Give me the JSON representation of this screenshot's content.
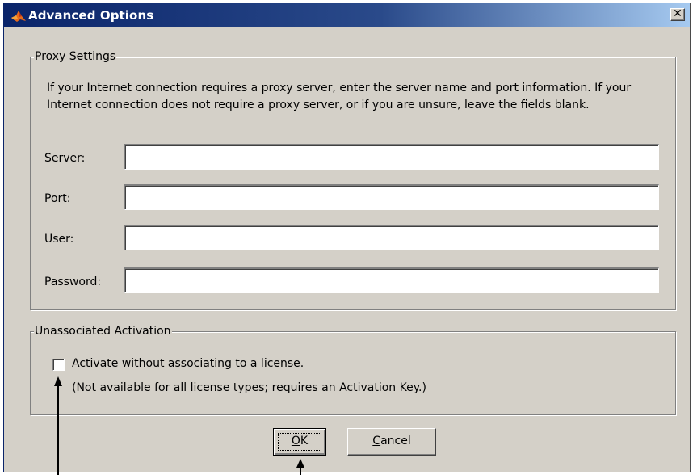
{
  "window": {
    "title": "Advanced Options",
    "close_glyph": "✕"
  },
  "proxy": {
    "legend": "Proxy Settings",
    "description": "If your Internet connection requires a proxy server, enter the server name and port information. If your Internet connection does not require a proxy server, or if you are unsure, leave the fields blank.",
    "server_label": "Server:",
    "server_value": "",
    "port_label": "Port:",
    "port_value": "",
    "user_label": "User:",
    "user_value": "",
    "password_label": "Password:",
    "password_value": ""
  },
  "activation": {
    "legend": "Unassociated Activation",
    "checkbox_label": "Activate without associating to a license.",
    "checked": false,
    "note": "(Not available for all license types; requires an Activation Key.)"
  },
  "buttons": {
    "ok_mnemonic": "O",
    "ok_rest": "K",
    "cancel_mnemonic": "C",
    "cancel_rest": "ancel"
  },
  "colors": {
    "titlebar_start": "#0a246a",
    "titlebar_end": "#a6caf0",
    "dialog_face": "#d4d0c8"
  },
  "icons": {
    "title": "matlab-logo-icon",
    "close": "close-icon",
    "annotation": "arrow-up-icon"
  }
}
